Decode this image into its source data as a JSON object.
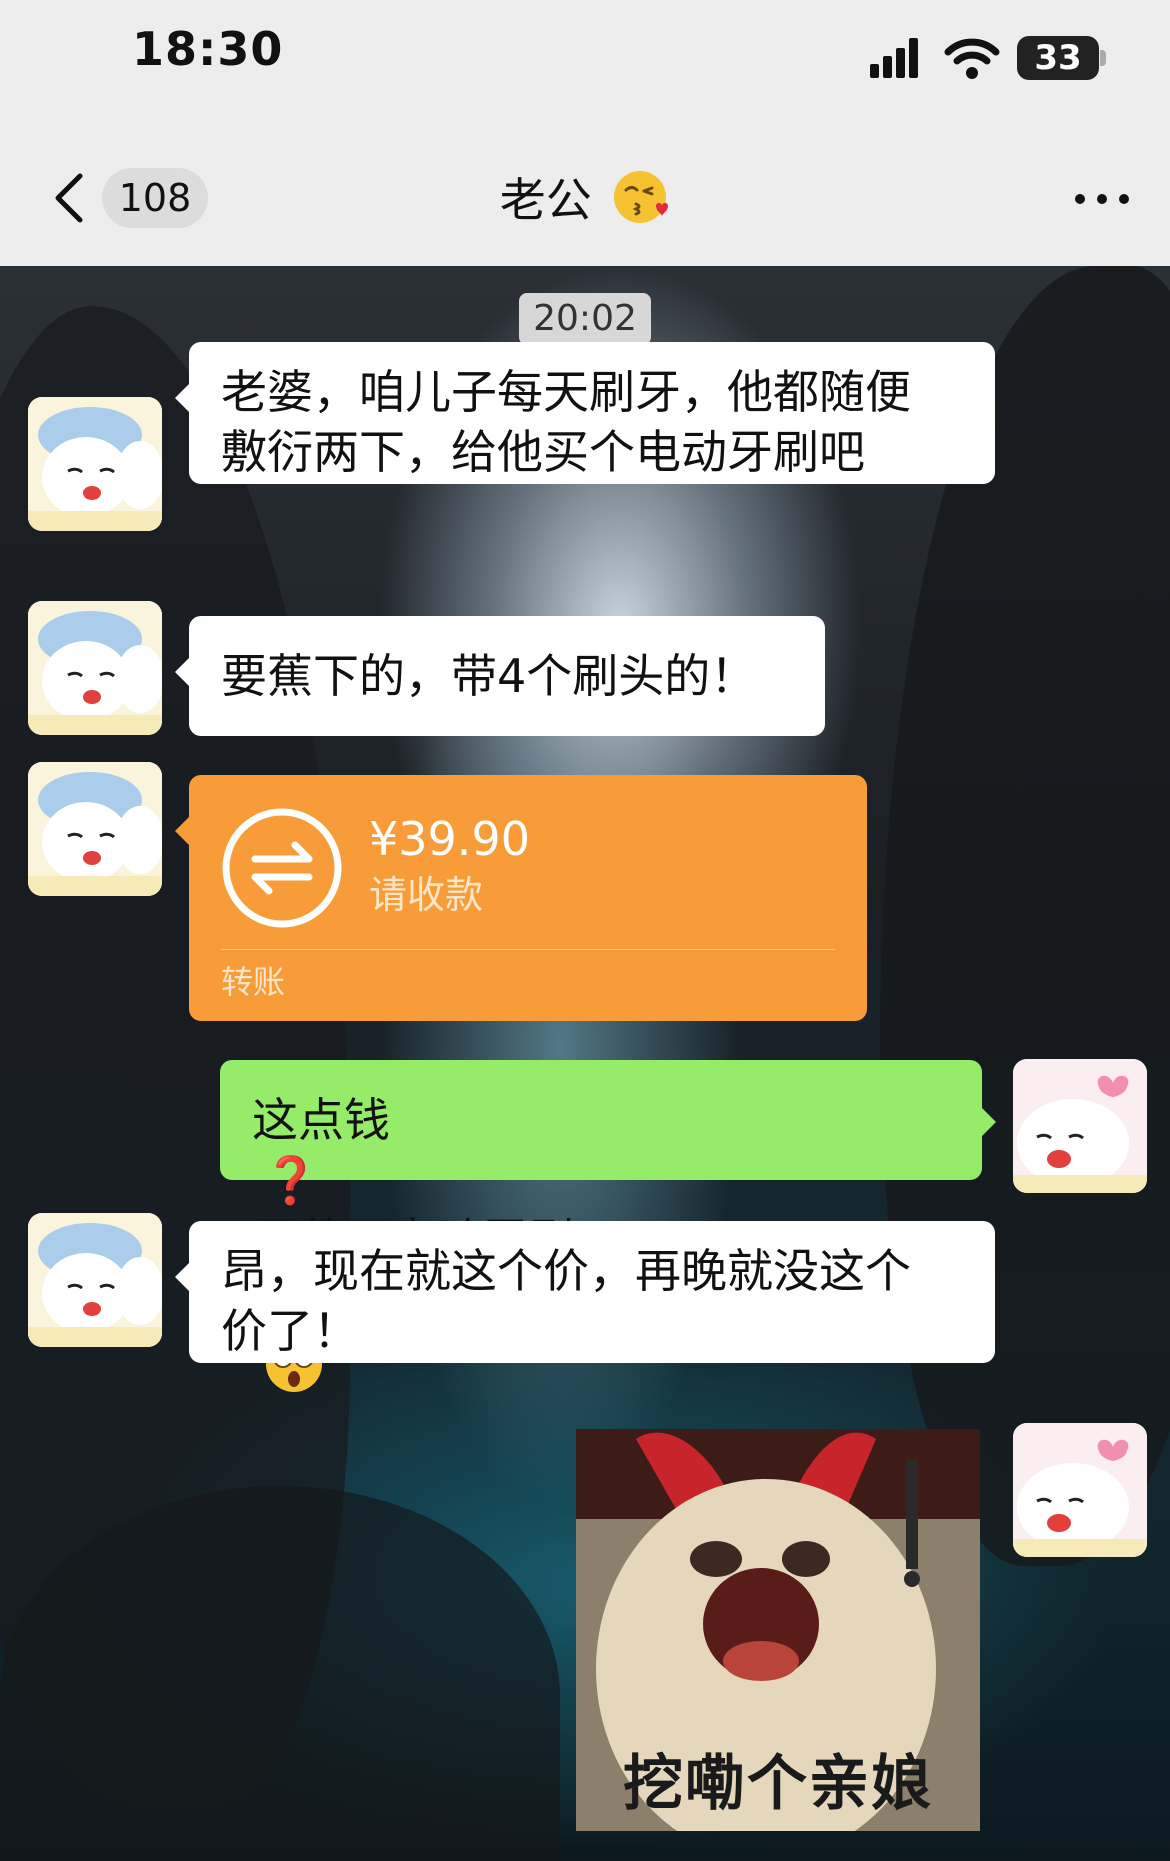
{
  "status_bar": {
    "time": "18:30",
    "battery_level": "33",
    "icons": [
      "signal-icon",
      "wifi-icon",
      "battery-icon"
    ]
  },
  "nav": {
    "unread_count": "108",
    "chat_title": "老公",
    "title_emoji": "kiss-emoji",
    "icons": [
      "back-arrow-icon",
      "more-icon"
    ]
  },
  "timestamp": "20:02",
  "messages": [
    {
      "sender": "other",
      "type": "text",
      "lines": [
        "老婆，咱儿子每天刷牙，他都随便",
        "敷衍两下，给他买个电动牙刷吧"
      ]
    },
    {
      "sender": "other",
      "type": "text",
      "lines": [
        "要蕉下的，带4个刷头的！"
      ]
    },
    {
      "sender": "other",
      "type": "transfer",
      "amount": "¥39.90",
      "status": "请收款",
      "label": "转账"
    },
    {
      "sender": "self",
      "type": "text",
      "parts": [
        "这点钱",
        "❓",
        "买蕉下电动牙刷",
        "❓"
      ],
      "emoji": "shocked-face-emoji"
    },
    {
      "sender": "other",
      "type": "text",
      "lines": [
        "昂，现在就这个价，再晚就没这个",
        "价了！"
      ]
    },
    {
      "sender": "self",
      "type": "sticker",
      "caption": "挖嘞个亲娘"
    }
  ],
  "colors": {
    "bar_bg": "#ededed",
    "self_bubble": "#95ec69",
    "other_bubble": "#ffffff",
    "transfer_card": "#f79c39",
    "question_mark": "#e0202a"
  }
}
